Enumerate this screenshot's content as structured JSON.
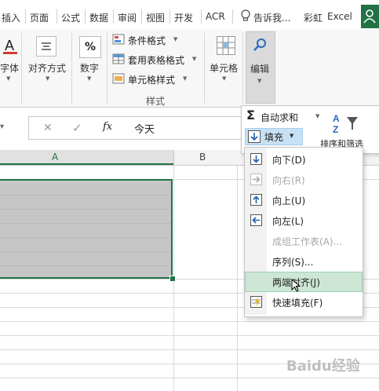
{
  "tabs": [
    "插入",
    "页面",
    "公式",
    "数据",
    "审阅",
    "视图",
    "开发",
    "ACR"
  ],
  "tell_me": "告诉我...",
  "user_name": "彩虹",
  "app_name": "Excel",
  "ribbon": {
    "font_label": "字体",
    "alignment_label": "对齐方式",
    "number_label": "数字",
    "number_icon_text": "%",
    "cond_format": "条件格式",
    "table_format": "套用表格格式",
    "cell_style": "单元格样式",
    "styles_group": "样式",
    "cells_label": "单元格",
    "editing_label": "编辑"
  },
  "formula_bar": {
    "fx": "fx",
    "content": "今天"
  },
  "columns": [
    "A",
    "B"
  ],
  "editing_panel": {
    "autosum": "自动求和",
    "fill": "填充",
    "sort": "排序和筛选"
  },
  "fill_menu": [
    {
      "label": "向下(D)",
      "enabled": true,
      "hover": false,
      "icon": "fill-down-icon"
    },
    {
      "label": "向右(R)",
      "enabled": false,
      "hover": false,
      "icon": "fill-right-icon"
    },
    {
      "label": "向上(U)",
      "enabled": true,
      "hover": false,
      "icon": "fill-up-icon"
    },
    {
      "label": "向左(L)",
      "enabled": true,
      "hover": false,
      "icon": "fill-left-icon"
    },
    {
      "label": "成组工作表(A)...",
      "enabled": false,
      "hover": false,
      "icon": ""
    },
    {
      "label": "序列(S)...",
      "enabled": true,
      "hover": false,
      "icon": ""
    },
    {
      "label": "两端对齐(J)",
      "enabled": true,
      "hover": true,
      "icon": ""
    },
    {
      "label": "快速填充(F)",
      "enabled": true,
      "hover": false,
      "icon": "flash-fill-icon"
    }
  ],
  "watermark": "Baidu经验",
  "colors": {
    "excel_green": "#217346",
    "selection_gray": "#c6c6c6",
    "hover_green": "#cde6d5"
  }
}
